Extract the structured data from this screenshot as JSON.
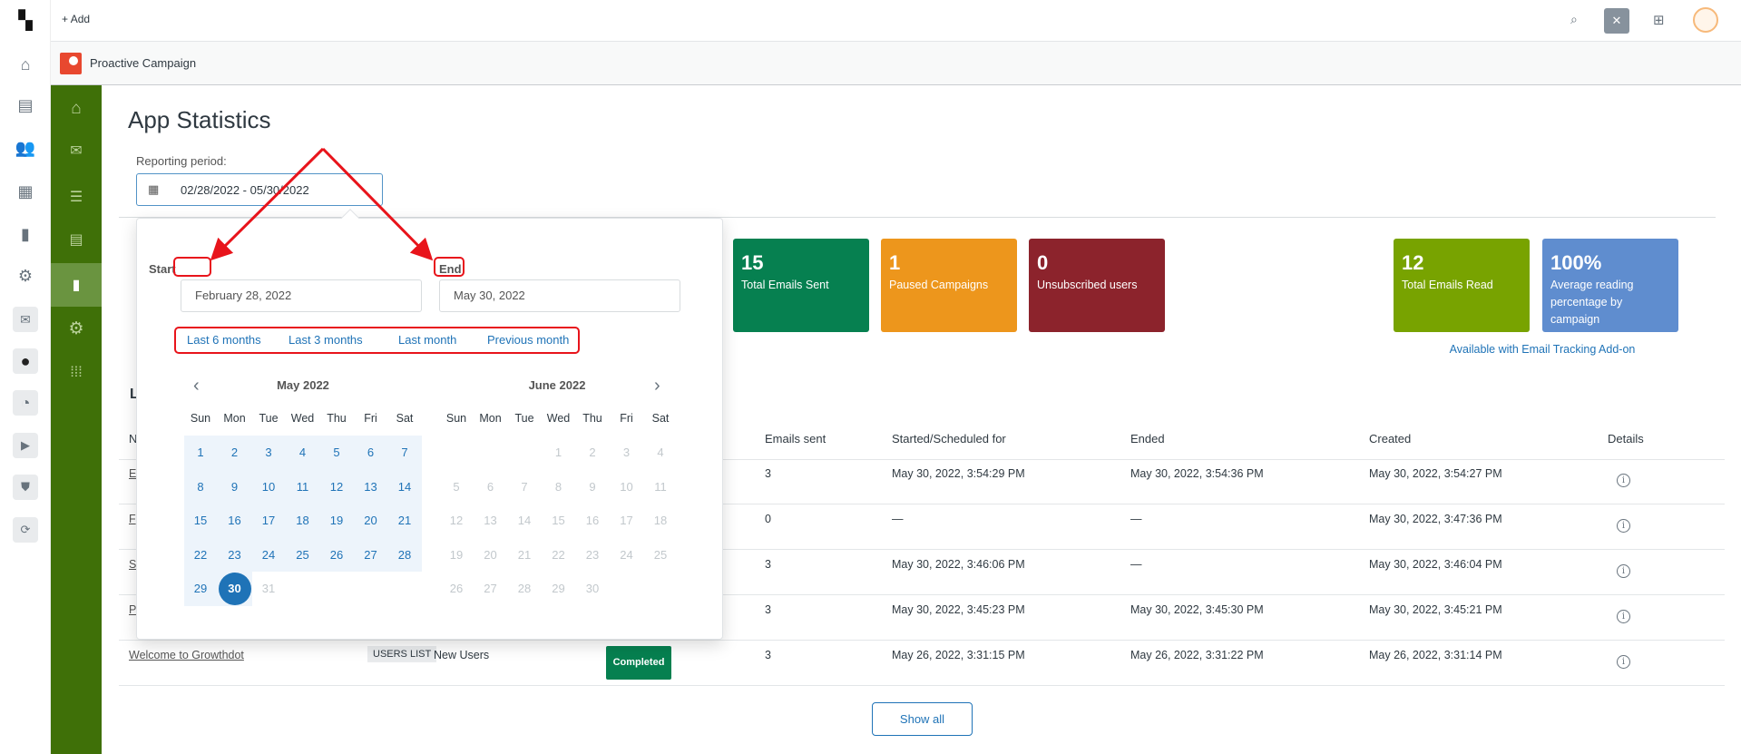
{
  "topbar": {
    "add_label": "Add"
  },
  "app": {
    "name": "Proactive Campaign"
  },
  "page": {
    "title": "App Statistics",
    "reporting_label": "Reporting period:",
    "reporting_value": "02/28/2022 - 05/30/2022"
  },
  "datepicker": {
    "start_label": "Start",
    "start_value": "February 28, 2022",
    "end_label": "End",
    "end_value": "May 30, 2022",
    "presets": [
      "Last 6 months",
      "Last 3 months",
      "Last month",
      "Previous month"
    ],
    "weekdays": [
      "Sun",
      "Mon",
      "Tue",
      "Wed",
      "Thu",
      "Fri",
      "Sat"
    ],
    "left_month": "May 2022",
    "right_month": "June 2022",
    "selected_day": "30",
    "range_color": "#edf4fb",
    "selected_color": "#1f73b7"
  },
  "cards": [
    {
      "value": "15",
      "label": "Total Emails Sent",
      "color": "#068050"
    },
    {
      "value": "1",
      "label": "Paused Campaigns",
      "color": "#ed961c"
    },
    {
      "value": "0",
      "label": "Unsubscribed users",
      "color": "#8c232c"
    },
    {
      "value": "12",
      "label": "Total Emails Read",
      "color": "#78a300"
    },
    {
      "value": "100%",
      "label": "Average reading percentage by campaign",
      "color": "#5f8dcf"
    }
  ],
  "tracking_note": "Available with Email Tracking Add-on",
  "table": {
    "heading_visible": "L",
    "headers": {
      "name": "N",
      "emails_sent": "Emails sent",
      "started": "Started/Scheduled for",
      "ended": "Ended",
      "created": "Created",
      "details": "Details"
    },
    "rows": [
      {
        "name": "E",
        "emails_sent": "3",
        "started": "May 30, 2022, 3:54:29 PM",
        "ended": "May 30, 2022, 3:54:36 PM",
        "created": "May 30, 2022, 3:54:27 PM"
      },
      {
        "name": "F",
        "emails_sent": "0",
        "started": "—",
        "ended": "—",
        "created": "May 30, 2022, 3:47:36 PM"
      },
      {
        "name": "S",
        "emails_sent": "3",
        "started": "May 30, 2022, 3:46:06 PM",
        "ended": "—",
        "created": "May 30, 2022, 3:46:04 PM"
      },
      {
        "name": "P",
        "emails_sent": "3",
        "started": "May 30, 2022, 3:45:23 PM",
        "ended": "May 30, 2022, 3:45:30 PM",
        "created": "May 30, 2022, 3:45:21 PM"
      },
      {
        "name": "Welcome to Growthdot",
        "audience_tag": "USERS LIST",
        "audience": "New Users",
        "status": "Completed",
        "emails_sent": "3",
        "started": "May 26, 2022, 3:31:15 PM",
        "ended": "May 26, 2022, 3:31:22 PM",
        "created": "May 26, 2022, 3:31:14 PM"
      }
    ],
    "show_all": "Show all"
  }
}
